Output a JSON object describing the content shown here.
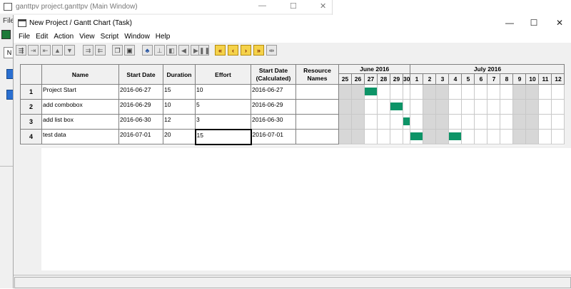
{
  "main_window": {
    "title": "ganttpv project.ganttpv (Main Window)",
    "menu_first": "File",
    "controls": [
      "—",
      "☐",
      "✕"
    ]
  },
  "window": {
    "title": "New Project / Gantt Chart (Task)",
    "controls": [
      "—",
      "☐",
      "✕"
    ]
  },
  "menu": [
    "File",
    "Edit",
    "Action",
    "View",
    "Script",
    "Window",
    "Help"
  ],
  "toolbar_icons": [
    "add-row-icon",
    "insert-row-icon",
    "delete-row-icon",
    "move-up-icon",
    "move-down-icon",
    "indent-icon",
    "outdent-icon",
    "copy-icon",
    "paste-icon",
    "group-icon",
    "link-icon",
    "level-icon",
    "zoom-out-icon",
    "zoom-in-icon",
    "stop-icon",
    "first-icon",
    "prev-icon",
    "next-icon",
    "last-icon",
    "fit-icon"
  ],
  "columns": [
    {
      "name": "Name"
    },
    {
      "name": "Start Date"
    },
    {
      "name": "Duration"
    },
    {
      "name": "Effort"
    },
    {
      "name": "Start Date (Calculated)"
    },
    {
      "name": "Resource Names"
    }
  ],
  "months": [
    "June 2016",
    "July 2016"
  ],
  "days": [
    "25",
    "26",
    "27",
    "28",
    "29",
    "30",
    "1",
    "2",
    "3",
    "4",
    "5",
    "6",
    "7",
    "8",
    "9",
    "10",
    "11",
    "12"
  ],
  "weekend_indices": [
    0,
    1,
    7,
    8,
    14,
    15
  ],
  "rows": [
    {
      "num": "1",
      "name": "Project Start",
      "start": "2016-06-27",
      "duration": "15",
      "effort": "10",
      "calc": "2016-06-27",
      "resources": "",
      "bars": [
        {
          "start": 2,
          "len": 2
        }
      ]
    },
    {
      "num": "2",
      "name": "add combobox",
      "start": "2016-06-29",
      "duration": "10",
      "effort": "5",
      "calc": "2016-06-29",
      "resources": "",
      "bars": [
        {
          "start": 4,
          "len": 1
        }
      ]
    },
    {
      "num": "3",
      "name": "add list box",
      "start": "2016-06-30",
      "duration": "12",
      "effort": "3",
      "calc": "2016-06-30",
      "resources": "",
      "bars": [
        {
          "start": 5,
          "len": 1
        }
      ]
    },
    {
      "num": "4",
      "name": "test data",
      "start": "2016-07-01",
      "duration": "20",
      "effort": "15",
      "calc": "2016-07-01",
      "resources": "",
      "bars": [
        {
          "start": 6,
          "len": 1
        },
        {
          "start": 9,
          "len": 1.5
        }
      ]
    }
  ],
  "colors": {
    "bar": "#0d9467",
    "weekend": "#d7d7d7"
  }
}
